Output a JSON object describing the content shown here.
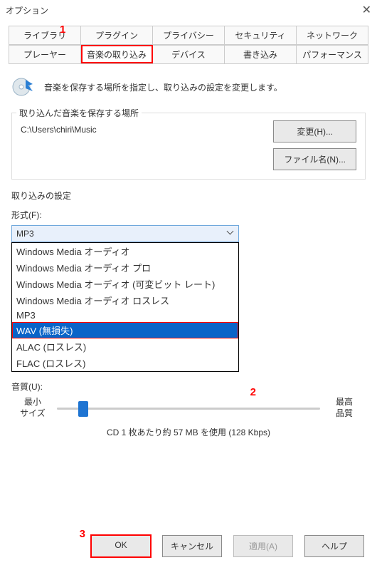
{
  "window": {
    "title": "オプション"
  },
  "tabs_row1": [
    {
      "label": "ライブラリ"
    },
    {
      "label": "プラグイン"
    },
    {
      "label": "プライバシー"
    },
    {
      "label": "セキュリティ"
    },
    {
      "label": "ネットワーク"
    }
  ],
  "tabs_row2": [
    {
      "label": "プレーヤー"
    },
    {
      "label": "音楽の取り込み"
    },
    {
      "label": "デバイス"
    },
    {
      "label": "書き込み"
    },
    {
      "label": "パフォーマンス"
    }
  ],
  "markers": {
    "m1": "1",
    "m2": "2",
    "m3": "3"
  },
  "header": {
    "text": "音楽を保存する場所を指定し、取り込みの設定を変更します。"
  },
  "save_loc": {
    "group_title": "取り込んだ音楽を保存する場所",
    "path": "C:\\Users\\chiri\\Music",
    "change_btn": "変更(H)...",
    "filename_btn": "ファイル名(N)..."
  },
  "settings": {
    "section_title": "取り込みの設定",
    "format_label": "形式(F):",
    "format_selected": "MP3",
    "format_options": [
      "Windows Media オーディオ",
      "Windows Media オーディオ プロ",
      "Windows Media オーディオ (可変ビット レート)",
      "Windows Media オーディオ ロスレス",
      "MP3",
      "WAV (無損失)",
      "ALAC (ロスレス)",
      "FLAC (ロスレス)"
    ],
    "highlighted_index": 5,
    "quality_label": "音質(U):",
    "slider_min_l1": "最小",
    "slider_min_l2": "サイズ",
    "slider_max_l1": "最高",
    "slider_max_l2": "品質",
    "size_note": "CD 1 枚あたり約 57 MB を使用 (128 Kbps)"
  },
  "footer": {
    "ok": "OK",
    "cancel": "キャンセル",
    "apply": "適用(A)",
    "help": "ヘルプ"
  }
}
